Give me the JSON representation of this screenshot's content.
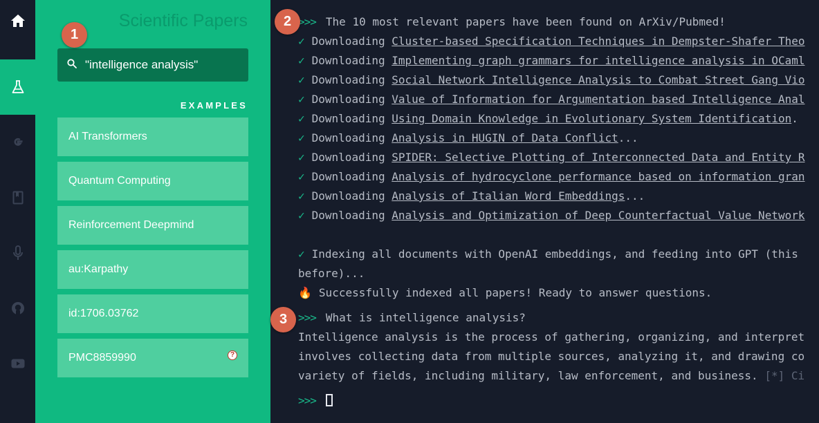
{
  "rail": {
    "items": [
      {
        "icon": "home-icon",
        "active": false
      },
      {
        "icon": "flask-icon",
        "active": true
      },
      {
        "icon": "google-icon",
        "active": false
      },
      {
        "icon": "book-icon",
        "active": false
      },
      {
        "icon": "microphone-icon",
        "active": false
      },
      {
        "icon": "github-icon",
        "active": false
      },
      {
        "icon": "youtube-icon",
        "active": false
      }
    ]
  },
  "sidebar": {
    "title": "Scientific Papers",
    "search_value": "\"intelligence analysis\"",
    "examples_label": "EXAMPLES",
    "examples": [
      "AI Transformers",
      "Quantum Computing",
      "Reinforcement Deepmind",
      "au:Karpathy",
      "id:1706.03762",
      "PMC8859990"
    ],
    "help_glyph": "?"
  },
  "terminal": {
    "prompt_symbol": ">>>",
    "check_symbol": "✓",
    "header": "The 10 most relevant papers have been found on ArXiv/Pubmed!",
    "download_prefix": "Downloading",
    "downloads": [
      {
        "title": "Cluster-based Specification Techniques in Dempster-Shafer Theo",
        "suffix": ""
      },
      {
        "title": "Implementing graph grammars for intelligence analysis in OCaml",
        "suffix": ""
      },
      {
        "title": "Social Network Intelligence Analysis to Combat Street Gang Vio",
        "suffix": ""
      },
      {
        "title": "Value of Information for Argumentation based Intelligence Anal",
        "suffix": ""
      },
      {
        "title": "Using Domain Knowledge in Evolutionary System Identification",
        "suffix": "."
      },
      {
        "title": "Analysis in HUGIN of Data Conflict",
        "suffix": "..."
      },
      {
        "title": "SPIDER: Selective Plotting of Interconnected Data and Entity R",
        "suffix": ""
      },
      {
        "title": "Analysis of hydrocyclone performance based on information gran",
        "suffix": ""
      },
      {
        "title": "Analysis of Italian Word Embeddings",
        "suffix": "..."
      },
      {
        "title": "Analysis and Optimization of Deep Counterfactual Value Network",
        "suffix": ""
      }
    ],
    "indexing_line1": "Indexing all documents with OpenAI embeddings, and feeding into GPT (this",
    "indexing_line2": "before)...",
    "success_symbol": "🔥",
    "success": "Successfully indexed all papers! Ready to answer questions.",
    "question": "What is intelligence analysis?",
    "answer_lines": [
      "Intelligence analysis is the process of gathering, organizing, and interpret",
      "involves collecting data from multiple sources, analyzing it, and drawing co",
      "variety of fields, including military, law enforcement, and business."
    ],
    "answer_cite": "[*] Ci"
  },
  "badges": [
    "1",
    "2",
    "3"
  ],
  "colors": {
    "accent": "#10b981",
    "background": "#161c2a",
    "badge": "#d8644c",
    "example_button": "#4fcf9f",
    "search_bg": "#08744f"
  }
}
